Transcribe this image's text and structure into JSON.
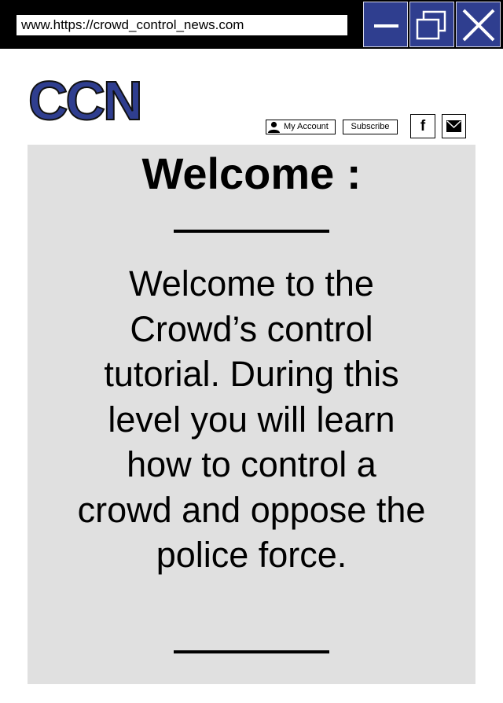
{
  "browser": {
    "url": "www.https://crowd_control_news.com",
    "window_buttons": {
      "minimize_icon": "minimize-icon",
      "maximize_icon": "maximize-icon",
      "close_icon": "close-icon"
    },
    "accent_color": "#2f3e8f"
  },
  "header": {
    "logo_text": "CCN",
    "account_label": "My Account",
    "account_icon": "person-icon",
    "subscribe_label": "Subscribe",
    "facebook_label": "f",
    "mail_icon": "mail-icon"
  },
  "main": {
    "title": "Welcome :",
    "body": "Welcome to the Crowd’s control tutorial. During this level you will learn how to control a crowd and oppose the police force.",
    "panel_color": "#e0e0e0"
  }
}
